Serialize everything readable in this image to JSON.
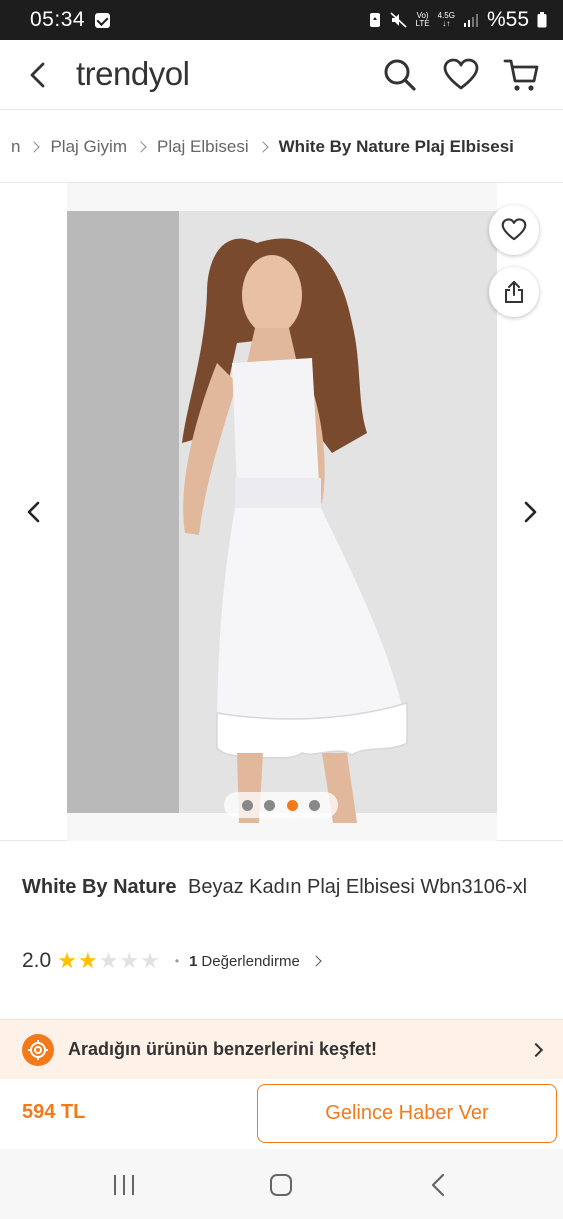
{
  "status_bar": {
    "time": "05:34",
    "network_top": "Vo)",
    "network_bottom": "LTE",
    "speed": "4.5G",
    "battery": "%55"
  },
  "header": {
    "logo": "trendyol",
    "icons": [
      "back-icon",
      "search-icon",
      "heart-icon",
      "cart-icon"
    ]
  },
  "breadcrumb": {
    "items": [
      "n",
      "Plaj Giyim",
      "Plaj Elbisesi",
      "White By Nature Plaj Elbisesi"
    ]
  },
  "gallery": {
    "image_count": 4,
    "active_index": 2
  },
  "product": {
    "brand": "White By Nature",
    "name": "Beyaz Kadın Plaj Elbisesi Wbn3106-xl",
    "rating": "2.0",
    "rating_value": 2,
    "rating_max": 5,
    "review_count": "1",
    "review_label": "Değerlendirme"
  },
  "discover": {
    "text": "Aradığın ürünün benzerlerini keşfet!"
  },
  "purchase": {
    "price": "594 TL",
    "notify_label": "Gelince Haber Ver"
  },
  "colors": {
    "accent": "#f27a1a",
    "star": "#ffc000",
    "discover_bg": "#fdf1e8"
  }
}
